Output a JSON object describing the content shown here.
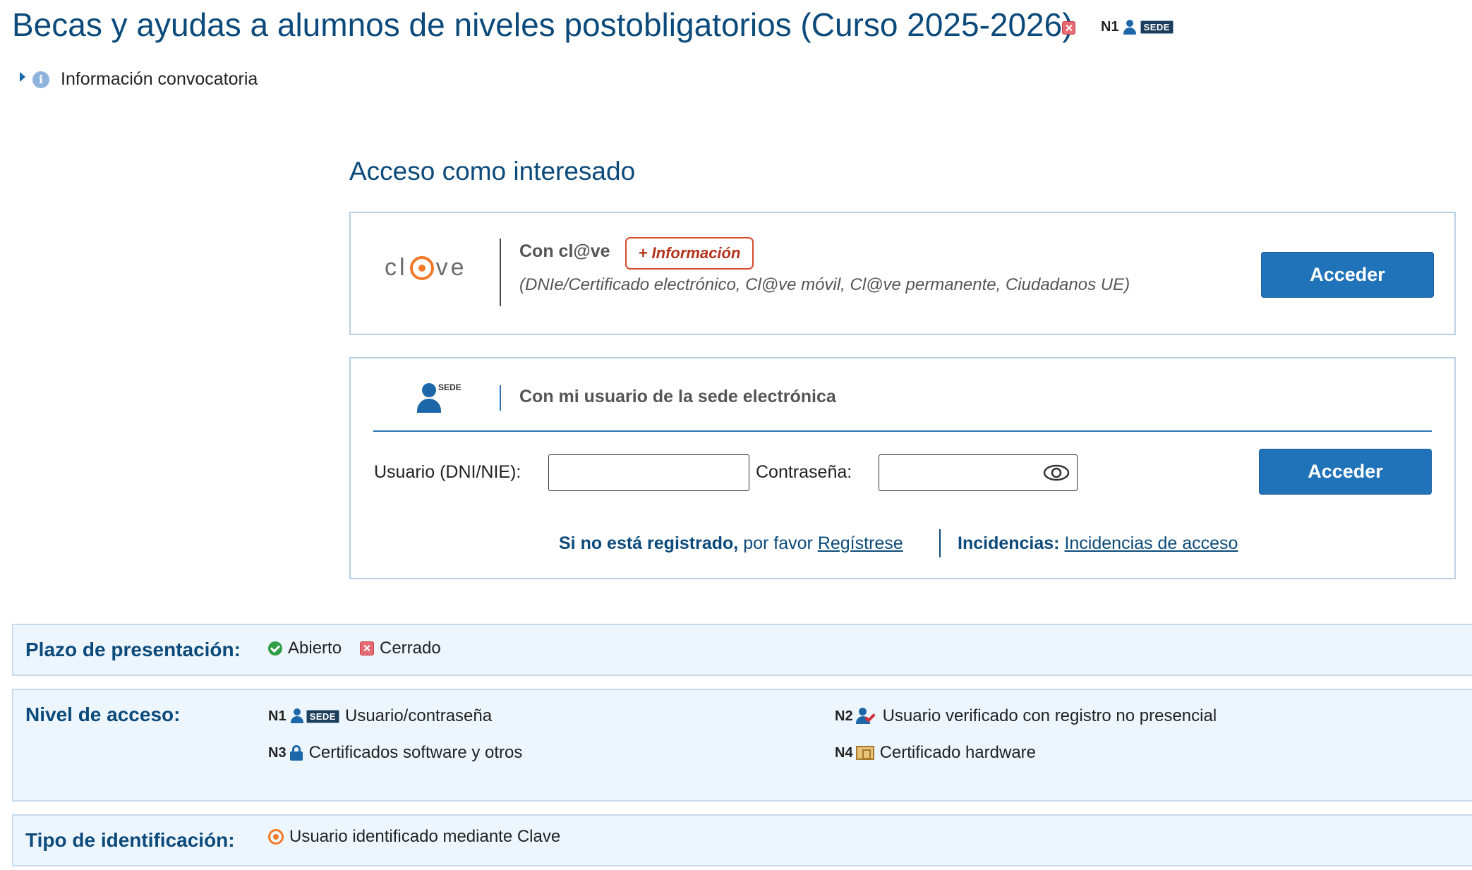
{
  "header": {
    "title": "Becas y ayudas a alumnos de niveles postobligatorios (Curso 2025-2026)",
    "status_icon": "closed-icon",
    "level": "N1",
    "sede_badge": "SEDE"
  },
  "info_toggle": {
    "label": "Información convocatoria"
  },
  "access": {
    "title": "Acceso como interesado",
    "clave": {
      "logo_left": "cl",
      "logo_right": "ve",
      "name": "Con cl@ve",
      "info_button": "+ Información",
      "description": "(DNIe/Certificado electrónico, Cl@ve móvil, Cl@ve permanente, Ciudadanos UE)",
      "button": "Acceder"
    },
    "sede": {
      "icon_text": "SEDE",
      "name": "Con mi usuario de la sede electrónica",
      "user_label": "Usuario (DNI/NIE):",
      "user_value": "",
      "password_label": "Contraseña:",
      "password_value": "",
      "button": "Acceder",
      "register_bold": "Si no está registrado,",
      "register_text": " por favor ",
      "register_link": "Regístrese",
      "incidents_bold": "Incidencias:",
      "incidents_link": "Incidencias de acceso"
    }
  },
  "plazo": {
    "title": "Plazo de presentación:",
    "open": "Abierto",
    "closed": "Cerrado"
  },
  "nivel": {
    "title": "Nivel de acceso:",
    "items": [
      {
        "level": "N1",
        "badge": "SEDE",
        "label": "Usuario/contraseña"
      },
      {
        "level": "N2",
        "label": "Usuario verificado con registro no presencial"
      },
      {
        "level": "N3",
        "label": "Certificados software y otros"
      },
      {
        "level": "N4",
        "label": "Certificado hardware"
      }
    ]
  },
  "tipo": {
    "title": "Tipo de identificación:",
    "label": "Usuario identificado mediante Clave"
  },
  "colors": {
    "title_blue": "#0b4a7a",
    "button_blue": "#2173b9",
    "clave_orange": "#f07a2a",
    "panel_bg": "#eef6fd"
  }
}
